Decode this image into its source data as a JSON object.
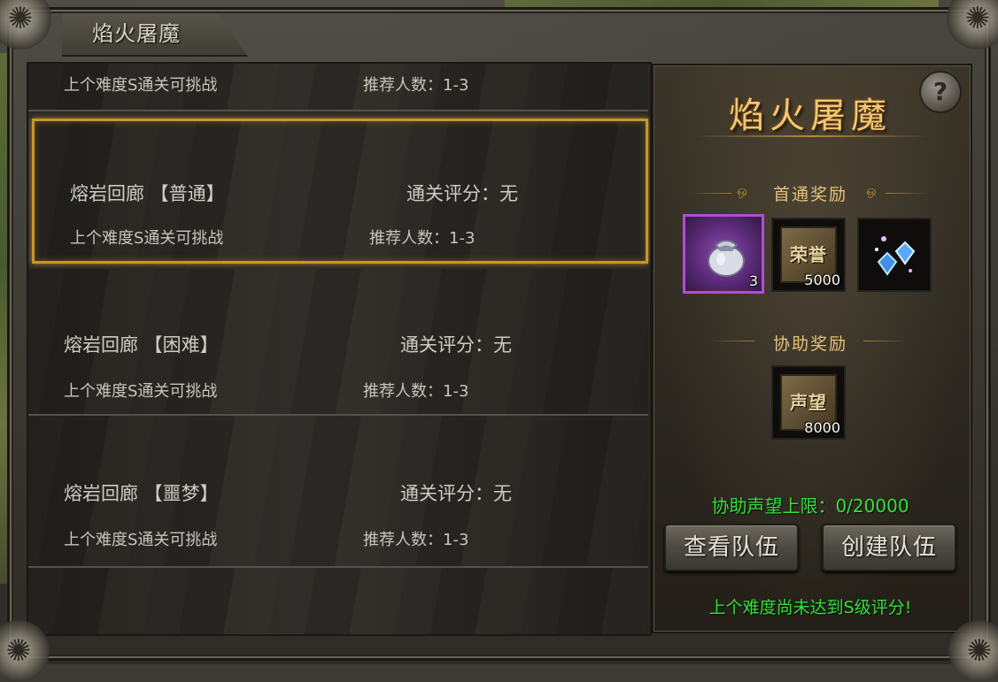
{
  "window": {
    "title": "焰火屠魔"
  },
  "list": {
    "rows": [
      {
        "name": "",
        "score": "",
        "requirement": "上个难度S通关可挑战",
        "recommended": "推荐人数：1-3"
      },
      {
        "name": "熔岩回廊 【普通】",
        "score": "通关评分：无",
        "requirement": "上个难度S通关可挑战",
        "recommended": "推荐人数：1-3"
      },
      {
        "name": "熔岩回廊 【困难】",
        "score": "通关评分：无",
        "requirement": "上个难度S通关可挑战",
        "recommended": "推荐人数：1-3"
      },
      {
        "name": "熔岩回廊 【噩梦】",
        "score": "通关评分：无",
        "requirement": "上个难度S通关可挑战",
        "recommended": "推荐人数：1-3"
      }
    ]
  },
  "detail": {
    "help": "?",
    "title": "焰火屠魔",
    "first_clear_label": "首通奖励",
    "assist_label": "协助奖励",
    "first_clear_rewards": [
      {
        "icon": "silver-pouch-icon",
        "count": "3",
        "rarity": "#b24cd6"
      },
      {
        "icon": "honor-scroll-icon",
        "text": "荣誉",
        "count": "5000"
      },
      {
        "icon": "blue-gems-icon",
        "count": ""
      }
    ],
    "assist_rewards": [
      {
        "icon": "reputation-scroll-icon",
        "text": "声望",
        "count": "8000"
      }
    ],
    "assist_limit": "协助声望上限：0/20000",
    "view_team": "查看队伍",
    "create_team": "创建队伍",
    "warning": "上个难度尚未达到S级评分!"
  },
  "colors": {
    "accent": "#f0c773",
    "highlight": "#35e23a",
    "selected_border": "#c8962b"
  }
}
